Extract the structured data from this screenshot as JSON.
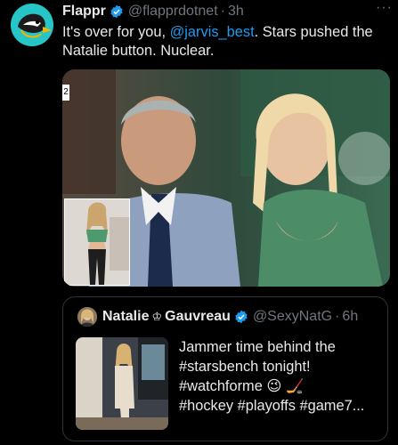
{
  "tweet": {
    "author_name": "Flappr",
    "author_handle": "@flapprdotnet",
    "separator": "·",
    "time": "3h",
    "more": "···",
    "text_before": "It's over for you, ",
    "mention": "@jarvis_best",
    "text_after": ".  Stars pushed the Natalie button. Nuclear.",
    "media_tag": "2"
  },
  "quote": {
    "author_name": "Natalie",
    "crown": "♔",
    "author_name2": "Gauvreau",
    "author_handle": "@SexyNatG",
    "separator": "·",
    "time": "6h",
    "line1": "Jammer time behind the",
    "line2": "#starsbench tonight!",
    "line3": "#watchforme 😉 🏒",
    "line4": "#hockey #playoffs #game7..."
  },
  "colors": {
    "accent": "#1d9bf0",
    "muted": "#71767b",
    "verified": "#1d9bf0"
  },
  "icons": [
    "flappr-avatar-icon",
    "verified-badge-icon",
    "more-icon"
  ]
}
